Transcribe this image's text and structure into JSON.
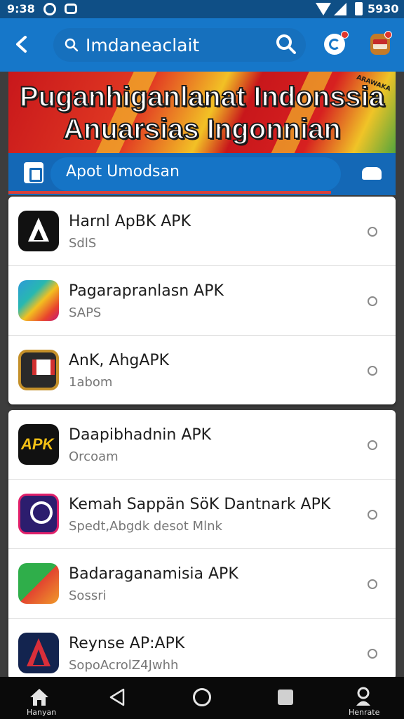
{
  "status_bar": {
    "time": "9:38",
    "battery_text": "5930"
  },
  "header": {
    "search_query": "Imdaneaclait"
  },
  "banner": {
    "line1": "Puganhiganlanat Indonssia",
    "line2": "Anuarsias Ingonnian",
    "corner_tag": "ARAWAKA"
  },
  "sub_bar": {
    "label": "Apot Umodsan"
  },
  "lists": [
    {
      "items": [
        {
          "name": "Harnl ApBK APK",
          "meta": "SdlS",
          "icon": "black-a-logo-icon"
        },
        {
          "name": "Pagarapranlasn APK",
          "meta": "SAPS",
          "icon": "colorful-play-logo-icon"
        },
        {
          "name": "AnK, AhgAPK",
          "meta": "1abom",
          "icon": "shield-badge-icon"
        }
      ]
    },
    {
      "items": [
        {
          "name": "Daapibhadnin APK",
          "meta": "Orcoam",
          "icon": "yellow-apk-logo-icon"
        },
        {
          "name": "Kemah Sappän SöK Dantnark APK",
          "meta": "Spedt,Abgdk desot Mlnk",
          "icon": "purple-circle-logo-icon"
        },
        {
          "name": "Badaraganamisia APK",
          "meta": "Sossri",
          "icon": "green-arrow-logo-icon"
        },
        {
          "name": "Reynse AP:APK",
          "meta": "SopoAcrolZ4Jwhh",
          "icon": "blue-red-a-logo-icon"
        }
      ]
    }
  ],
  "apk_icon_text": "APK",
  "nav_bar": {
    "home_label": "Hanyan",
    "profile_label": "Henrate"
  },
  "colors": {
    "primary": "#1677c9",
    "header_dark": "#0f4f86",
    "banner_red": "#c8171b",
    "banner_yellow": "#f2c125",
    "badge_red": "#e0362c"
  }
}
